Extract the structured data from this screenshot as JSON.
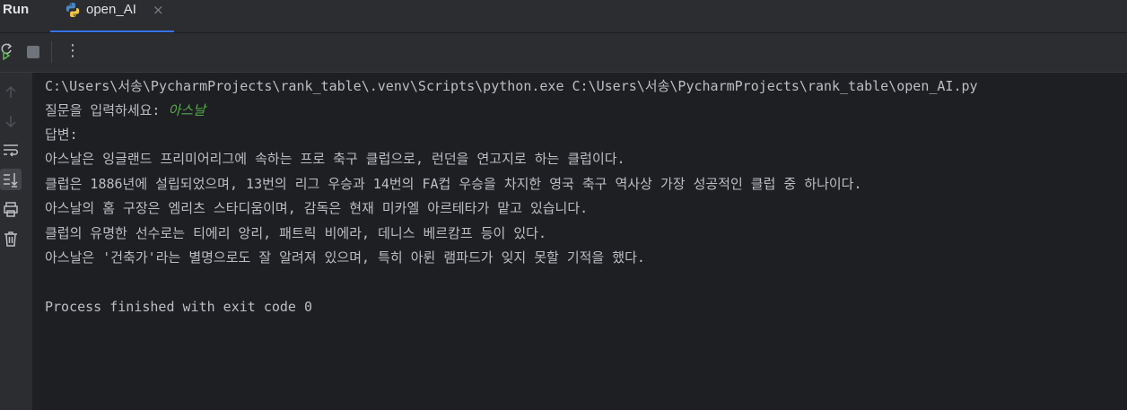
{
  "panel": {
    "title": "Run",
    "tab_label": "open_AI",
    "close_glyph": "×"
  },
  "toolbar": {
    "rerun_icon": "rerun-icon",
    "stop_icon": "stop-icon",
    "more_icon": "more-vertical-icon",
    "more_glyph": "⋮"
  },
  "sidebar": {
    "icons": [
      "arrow-up-icon",
      "arrow-down-icon",
      "soft-wrap-icon",
      "scroll-to-end-icon",
      "print-icon",
      "trash-icon"
    ]
  },
  "console": {
    "command": "C:\\Users\\서송\\PycharmProjects\\rank_table\\.venv\\Scripts\\python.exe C:\\Users\\서송\\PycharmProjects\\rank_table\\open_AI.py",
    "prompt": "질문을 입력하세요: ",
    "user_input": "아스날",
    "answer_header": "답변:",
    "answer_lines": [
      "아스날은 잉글랜드 프리미어리그에 속하는 프로 축구 클럽으로, 런던을 연고지로 하는 클럽이다.",
      "클럽은 1886년에 설립되었으며, 13번의 리그 우승과 14번의 FA컵 우승을 차지한 영국 축구 역사상 가장 성공적인 클럽 중 하나이다.",
      "아스날의 홈 구장은 엠리츠 스타디움이며, 감독은 현재 미카엘 아르테타가 맡고 있습니다.",
      "클럽의 유명한 선수로는 티에리 앙리, 패트릭 비에라, 데니스 베르캄프 등이 있다.",
      "아스날은 '건축가'라는 별명으로도 잘 알려져 있으며, 특히 아륀 램파드가 잊지 못할 기적을 했다."
    ],
    "exit_message": "Process finished with exit code 0"
  },
  "colors": {
    "background": "#1e1f22",
    "panel": "#2b2d30",
    "text": "#bcbec4",
    "user_input": "#56a84c",
    "accent": "#3574f0"
  }
}
